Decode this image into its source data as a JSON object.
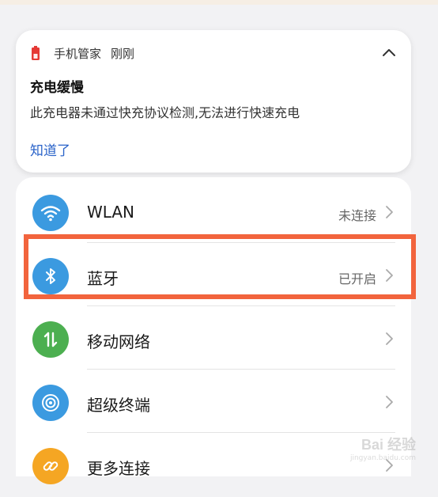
{
  "notification": {
    "app": "手机管家",
    "time": "刚刚",
    "title": "充电缓慢",
    "body": "此充电器未通过快充协议检测,无法进行快速充电",
    "action": "知道了"
  },
  "settings": {
    "items": [
      {
        "label": "WLAN",
        "status": "未连接",
        "icon": "wifi-icon",
        "color": "#3b9ae0"
      },
      {
        "label": "蓝牙",
        "status": "已开启",
        "icon": "bluetooth-icon",
        "color": "#3b9ae0"
      },
      {
        "label": "移动网络",
        "status": "",
        "icon": "mobile-data-icon",
        "color": "#4caf50"
      },
      {
        "label": "超级终端",
        "status": "",
        "icon": "super-device-icon",
        "color": "#3b9ae0"
      },
      {
        "label": "更多连接",
        "status": "",
        "icon": "link-icon",
        "color": "#f5a623"
      }
    ]
  },
  "colors": {
    "accent": "#2a63c9",
    "highlight": "#f2643d",
    "battery": "#e53935"
  },
  "watermark": {
    "logo": "Bai 经验",
    "url": "jingyan.baidu.com"
  }
}
